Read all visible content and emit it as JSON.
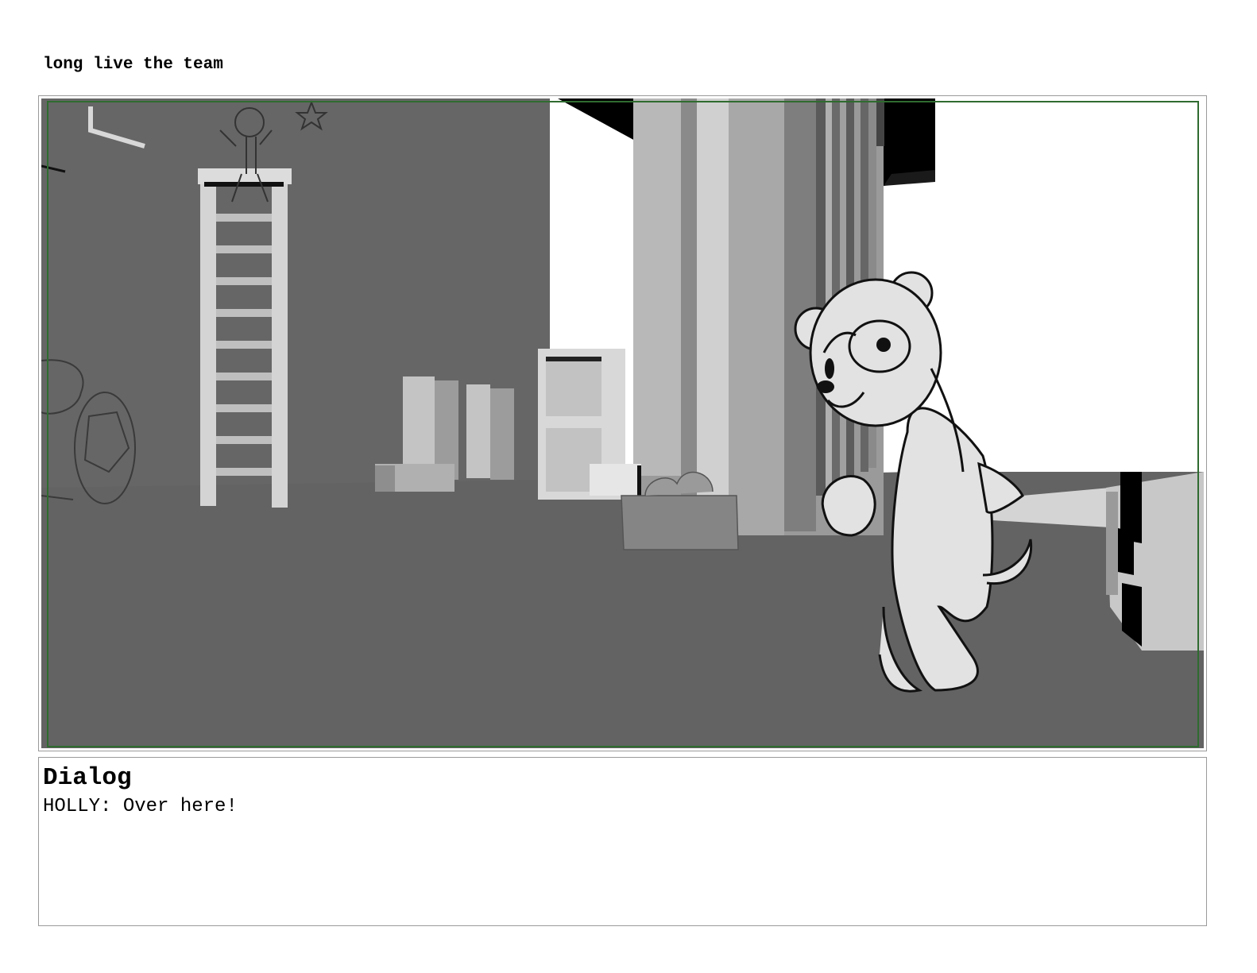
{
  "header": {
    "title": "long live the team"
  },
  "panel": {
    "frame_border_color": "#9a9a9a",
    "safe_area_color": "#2f6b2f",
    "floor_color": "#636363",
    "wall_color": "#666666",
    "character_fill": "#e2e2e2"
  },
  "dialog": {
    "heading": "Dialog",
    "line": "HOLLY: Over here!"
  }
}
